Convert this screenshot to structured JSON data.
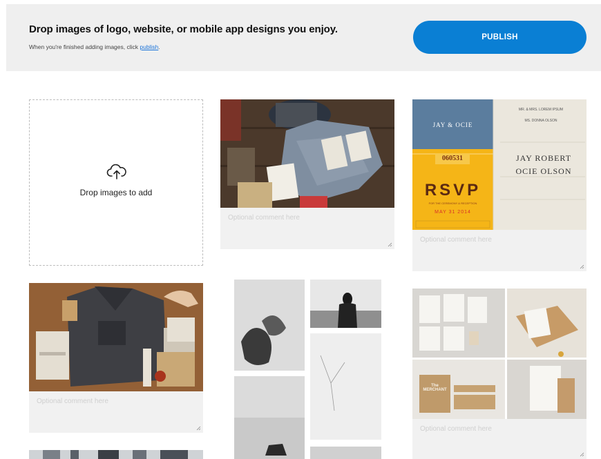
{
  "header": {
    "title": "Drop images of logo, website, or mobile app designs you enjoy.",
    "subtitle_prefix": "When you're finished adding images, click ",
    "subtitle_link": "publish",
    "subtitle_suffix": ".",
    "publish_label": "PUBLISH"
  },
  "dropzone": {
    "label": "Drop images to add",
    "icon": "cloud-upload-icon"
  },
  "cards": [
    {
      "id": "tshirt",
      "comment_placeholder": "Optional comment here"
    },
    {
      "id": "wedding",
      "comment_placeholder": "Optional comment here"
    },
    {
      "id": "hoodie",
      "comment_placeholder": "Optional comment here"
    },
    {
      "id": "merchant",
      "comment_placeholder": "Optional comment here"
    }
  ],
  "wedding_text": {
    "top_left_name": "JAY & OCIE",
    "ticket_number": "060531",
    "rsvp": "RSVP",
    "rsvp_sub": "FOR THE CEREMONY & RECEPTION",
    "rsvp_date": "MAY 31 2014",
    "right_names_line1": "MR. & MRS. LOREM IPSUM",
    "right_names_line2": "MS. DONNA OLSON",
    "big_name_1": "JAY ROBERT",
    "big_name_2": "OCIE OLSON"
  },
  "merchant_text": {
    "label": "The MERCHANT"
  },
  "colors": {
    "publish": "#0a7fd4",
    "link": "#1a73d9",
    "wedding_blue": "#5b7d9e",
    "wedding_yellow": "#f5b517"
  }
}
